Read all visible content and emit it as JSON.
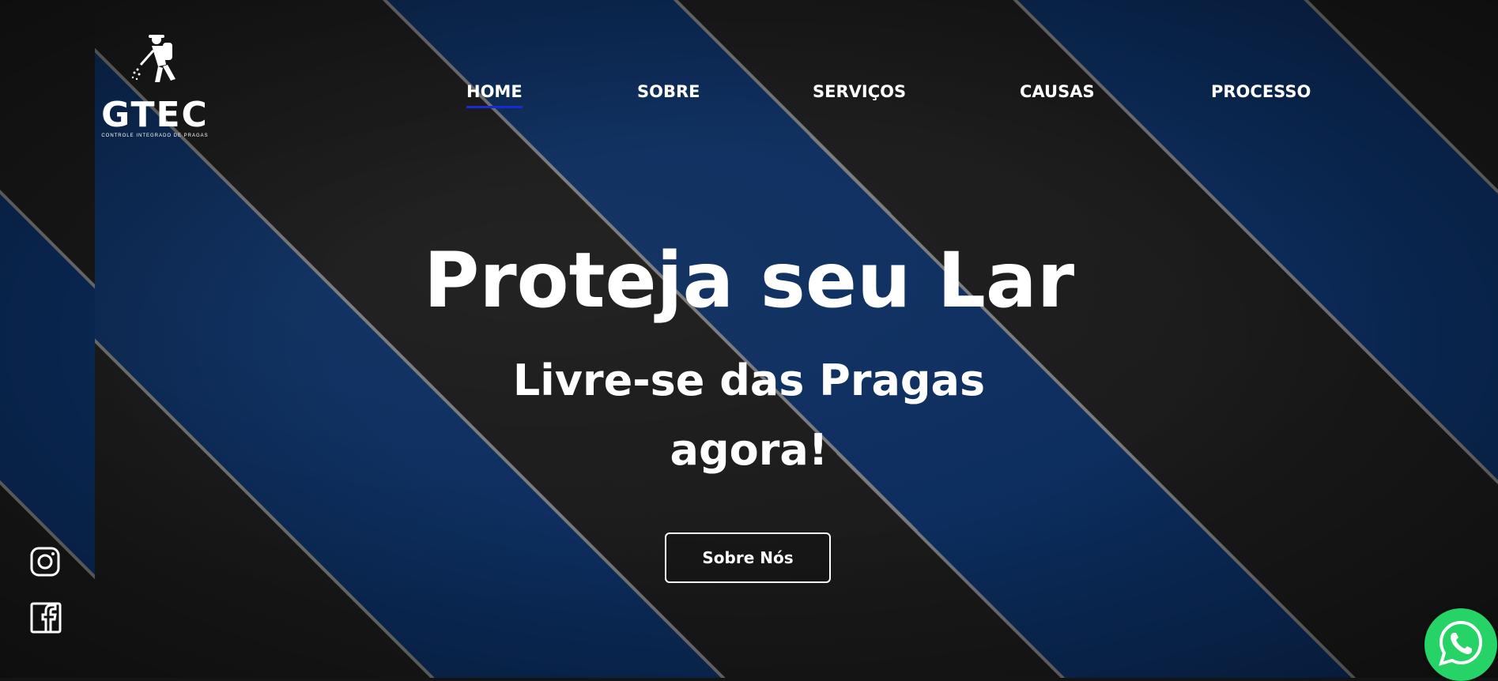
{
  "logo": {
    "name": "GTEC",
    "tagline": "CONTROLE INTEGRADO DE PRAGAS",
    "icon": "pest-sprayer-icon"
  },
  "nav": {
    "items": [
      {
        "label": "HOME",
        "active": true
      },
      {
        "label": "SOBRE",
        "active": false
      },
      {
        "label": "SERVIÇOS",
        "active": false
      },
      {
        "label": "CAUSAS",
        "active": false
      },
      {
        "label": "PROCESSO",
        "active": false
      }
    ]
  },
  "hero": {
    "title": "Proteja seu Lar",
    "subtitle_line1": "Livre-se das Pragas",
    "subtitle_line2": "agora!",
    "cta_label": "Sobre Nós"
  },
  "social": {
    "instagram_icon": "instagram-icon",
    "facebook_icon": "facebook-icon"
  },
  "whatsapp": {
    "icon": "whatsapp-icon"
  },
  "colors": {
    "nav_active_underline": "#1a2bd6",
    "stripe_blue": "#0b2d5e",
    "stripe_dark": "#1a1a1a",
    "whatsapp_green": "#25d366"
  }
}
